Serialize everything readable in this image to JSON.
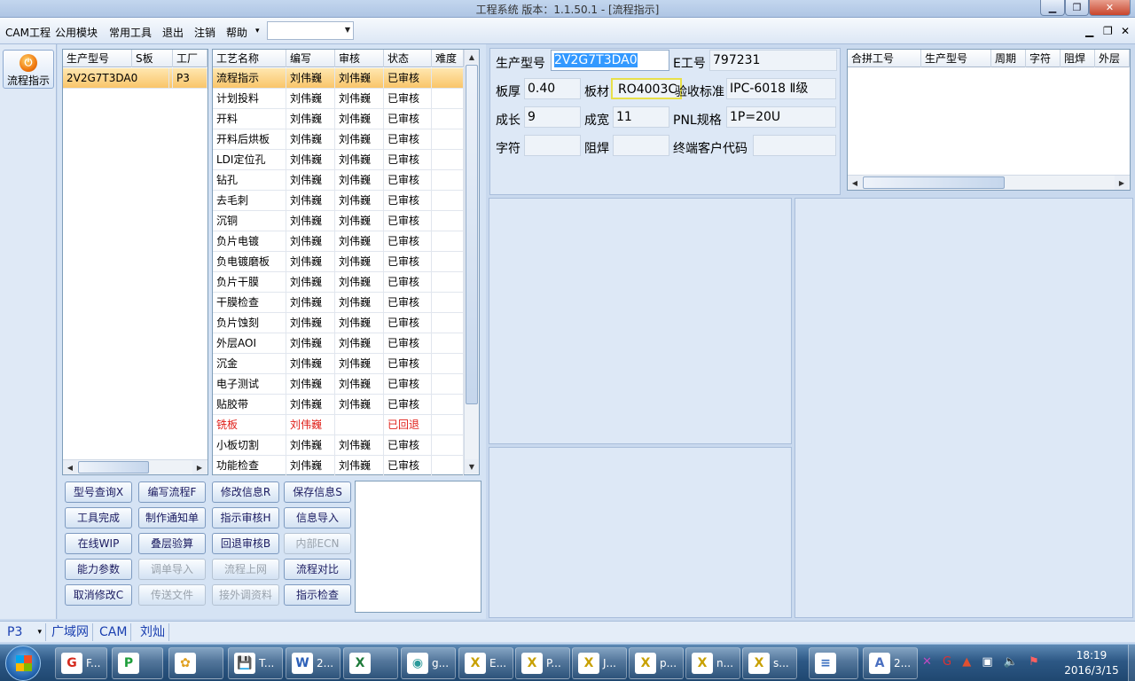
{
  "window": {
    "title": "工程系统   版本：1.1.50.1 - [流程指示]"
  },
  "menu": {
    "items": [
      "CAM工程",
      "公用模块",
      "常用工具",
      "退出",
      "注销",
      "帮助"
    ],
    "help_arrow": "▾",
    "combo_value": ""
  },
  "sidebar": {
    "flow_button": "流程指示"
  },
  "model_list": {
    "headers": [
      "生产型号",
      "S板",
      "工厂"
    ],
    "rows": [
      [
        "2V2G7T3DA0",
        "",
        "P3"
      ]
    ]
  },
  "process_table": {
    "headers": [
      "工艺名称",
      "编写",
      "审核",
      "状态",
      "难度"
    ],
    "rows": [
      {
        "name": "流程指示",
        "writer": "刘伟巍",
        "reviewer": "刘伟巍",
        "status": "已审核",
        "difficulty": "",
        "selected": true,
        "red": false
      },
      {
        "name": "计划投料",
        "writer": "刘伟巍",
        "reviewer": "刘伟巍",
        "status": "已审核",
        "difficulty": "",
        "selected": false,
        "red": false
      },
      {
        "name": "开料",
        "writer": "刘伟巍",
        "reviewer": "刘伟巍",
        "status": "已审核",
        "difficulty": "",
        "selected": false,
        "red": false
      },
      {
        "name": "开料后烘板",
        "writer": "刘伟巍",
        "reviewer": "刘伟巍",
        "status": "已审核",
        "difficulty": "",
        "selected": false,
        "red": false
      },
      {
        "name": "LDI定位孔",
        "writer": "刘伟巍",
        "reviewer": "刘伟巍",
        "status": "已审核",
        "difficulty": "",
        "selected": false,
        "red": false
      },
      {
        "name": "钻孔",
        "writer": "刘伟巍",
        "reviewer": "刘伟巍",
        "status": "已审核",
        "difficulty": "",
        "selected": false,
        "red": false
      },
      {
        "name": "去毛刺",
        "writer": "刘伟巍",
        "reviewer": "刘伟巍",
        "status": "已审核",
        "difficulty": "",
        "selected": false,
        "red": false
      },
      {
        "name": "沉铜",
        "writer": "刘伟巍",
        "reviewer": "刘伟巍",
        "status": "已审核",
        "difficulty": "",
        "selected": false,
        "red": false
      },
      {
        "name": "负片电镀",
        "writer": "刘伟巍",
        "reviewer": "刘伟巍",
        "status": "已审核",
        "difficulty": "",
        "selected": false,
        "red": false
      },
      {
        "name": "负电镀磨板",
        "writer": "刘伟巍",
        "reviewer": "刘伟巍",
        "status": "已审核",
        "difficulty": "",
        "selected": false,
        "red": false
      },
      {
        "name": "负片干膜",
        "writer": "刘伟巍",
        "reviewer": "刘伟巍",
        "status": "已审核",
        "difficulty": "",
        "selected": false,
        "red": false
      },
      {
        "name": "干膜检查",
        "writer": "刘伟巍",
        "reviewer": "刘伟巍",
        "status": "已审核",
        "difficulty": "",
        "selected": false,
        "red": false
      },
      {
        "name": "负片蚀刻",
        "writer": "刘伟巍",
        "reviewer": "刘伟巍",
        "status": "已审核",
        "difficulty": "",
        "selected": false,
        "red": false
      },
      {
        "name": "外层AOI",
        "writer": "刘伟巍",
        "reviewer": "刘伟巍",
        "status": "已审核",
        "difficulty": "",
        "selected": false,
        "red": false
      },
      {
        "name": "沉金",
        "writer": "刘伟巍",
        "reviewer": "刘伟巍",
        "status": "已审核",
        "difficulty": "",
        "selected": false,
        "red": false
      },
      {
        "name": "电子测试",
        "writer": "刘伟巍",
        "reviewer": "刘伟巍",
        "status": "已审核",
        "difficulty": "",
        "selected": false,
        "red": false
      },
      {
        "name": "贴胶带",
        "writer": "刘伟巍",
        "reviewer": "刘伟巍",
        "status": "已审核",
        "difficulty": "",
        "selected": false,
        "red": false
      },
      {
        "name": "铣板",
        "writer": "刘伟巍",
        "reviewer": "",
        "status": "已回退",
        "difficulty": "",
        "selected": false,
        "red": true
      },
      {
        "name": "小板切割",
        "writer": "刘伟巍",
        "reviewer": "刘伟巍",
        "status": "已审核",
        "difficulty": "",
        "selected": false,
        "red": false
      },
      {
        "name": "功能检查",
        "writer": "刘伟巍",
        "reviewer": "刘伟巍",
        "status": "已审核",
        "difficulty": "",
        "selected": false,
        "red": false
      }
    ]
  },
  "buttons": [
    [
      {
        "label": "型号查询X",
        "disabled": false
      },
      {
        "label": "编写流程F",
        "disabled": false
      },
      {
        "label": "修改信息R",
        "disabled": false
      },
      {
        "label": "保存信息S",
        "disabled": false
      }
    ],
    [
      {
        "label": "工具完成",
        "disabled": false
      },
      {
        "label": "制作通知单",
        "disabled": false
      },
      {
        "label": "指示审核H",
        "disabled": false
      },
      {
        "label": "信息导入",
        "disabled": false
      }
    ],
    [
      {
        "label": "在线WIP",
        "disabled": false
      },
      {
        "label": "叠层验算",
        "disabled": false
      },
      {
        "label": "回退审核B",
        "disabled": false
      },
      {
        "label": "内部ECN",
        "disabled": true
      }
    ],
    [
      {
        "label": "能力参数",
        "disabled": false
      },
      {
        "label": "调单导入",
        "disabled": true
      },
      {
        "label": "流程上网",
        "disabled": true
      },
      {
        "label": "流程对比",
        "disabled": false
      }
    ],
    [
      {
        "label": "取消修改C",
        "disabled": false
      },
      {
        "label": "传送文件",
        "disabled": true
      },
      {
        "label": "接外调资料",
        "disabled": true
      },
      {
        "label": "指示检查",
        "disabled": false
      }
    ]
  ],
  "info": {
    "model_label": "生产型号",
    "model_value": "2V2G7T3DA0",
    "ework_label": "E工号",
    "ework_value": "797231",
    "thickness_label": "板厚",
    "thickness_value": "0.40",
    "material_label": "板材",
    "material_value": "RO4003C",
    "accept_label": "验收标准",
    "accept_value": "IPC-6018 Ⅱ级",
    "length_label": "成长",
    "length_value": "9",
    "width_label": "成宽",
    "width_value": "11",
    "pnl_label": "PNL规格",
    "pnl_value": "1P=20U",
    "char_label": "字符",
    "char_value": "",
    "mask_label": "阻焊",
    "mask_value": "",
    "client_label": "终端客户代码",
    "client_value": ""
  },
  "merge_table": {
    "headers": [
      "合拼工号",
      "生产型号",
      "周期",
      "字符",
      "阻焊",
      "外层"
    ]
  },
  "status": {
    "items": [
      "P3",
      "广域网",
      "CAM",
      "刘灿"
    ],
    "arrow": "▾"
  },
  "taskbar": {
    "apps": [
      {
        "label": "F...",
        "icon": "G",
        "color": "#d52b1e"
      },
      {
        "label": "",
        "icon": "P",
        "color": "#1e9e3a"
      },
      {
        "label": "",
        "icon": "✿",
        "color": "#e0a020"
      },
      {
        "label": "T...",
        "icon": "💾",
        "color": "#3a5fc0"
      },
      {
        "label": "2...",
        "icon": "W",
        "color": "#2b5fb8"
      },
      {
        "label": "",
        "icon": "X",
        "color": "#1e7a3a"
      },
      {
        "label": "g...",
        "icon": "◉",
        "color": "#2a9a9a"
      },
      {
        "label": "E...",
        "icon": "X",
        "color": "#c8a000"
      },
      {
        "label": "P...",
        "icon": "X",
        "color": "#c8a000"
      },
      {
        "label": "J...",
        "icon": "X",
        "color": "#c8a000"
      },
      {
        "label": "p...",
        "icon": "X",
        "color": "#c8a000"
      },
      {
        "label": "n...",
        "icon": "X",
        "color": "#c8a000"
      },
      {
        "label": "s...",
        "icon": "X",
        "color": "#c8a000"
      },
      {
        "label": "",
        "icon": "≡",
        "color": "#3a6fc0"
      },
      {
        "label": "2...",
        "icon": "A",
        "color": "#4a6fc0"
      }
    ],
    "clock_time": "18:19",
    "clock_date": "2016/3/15"
  }
}
